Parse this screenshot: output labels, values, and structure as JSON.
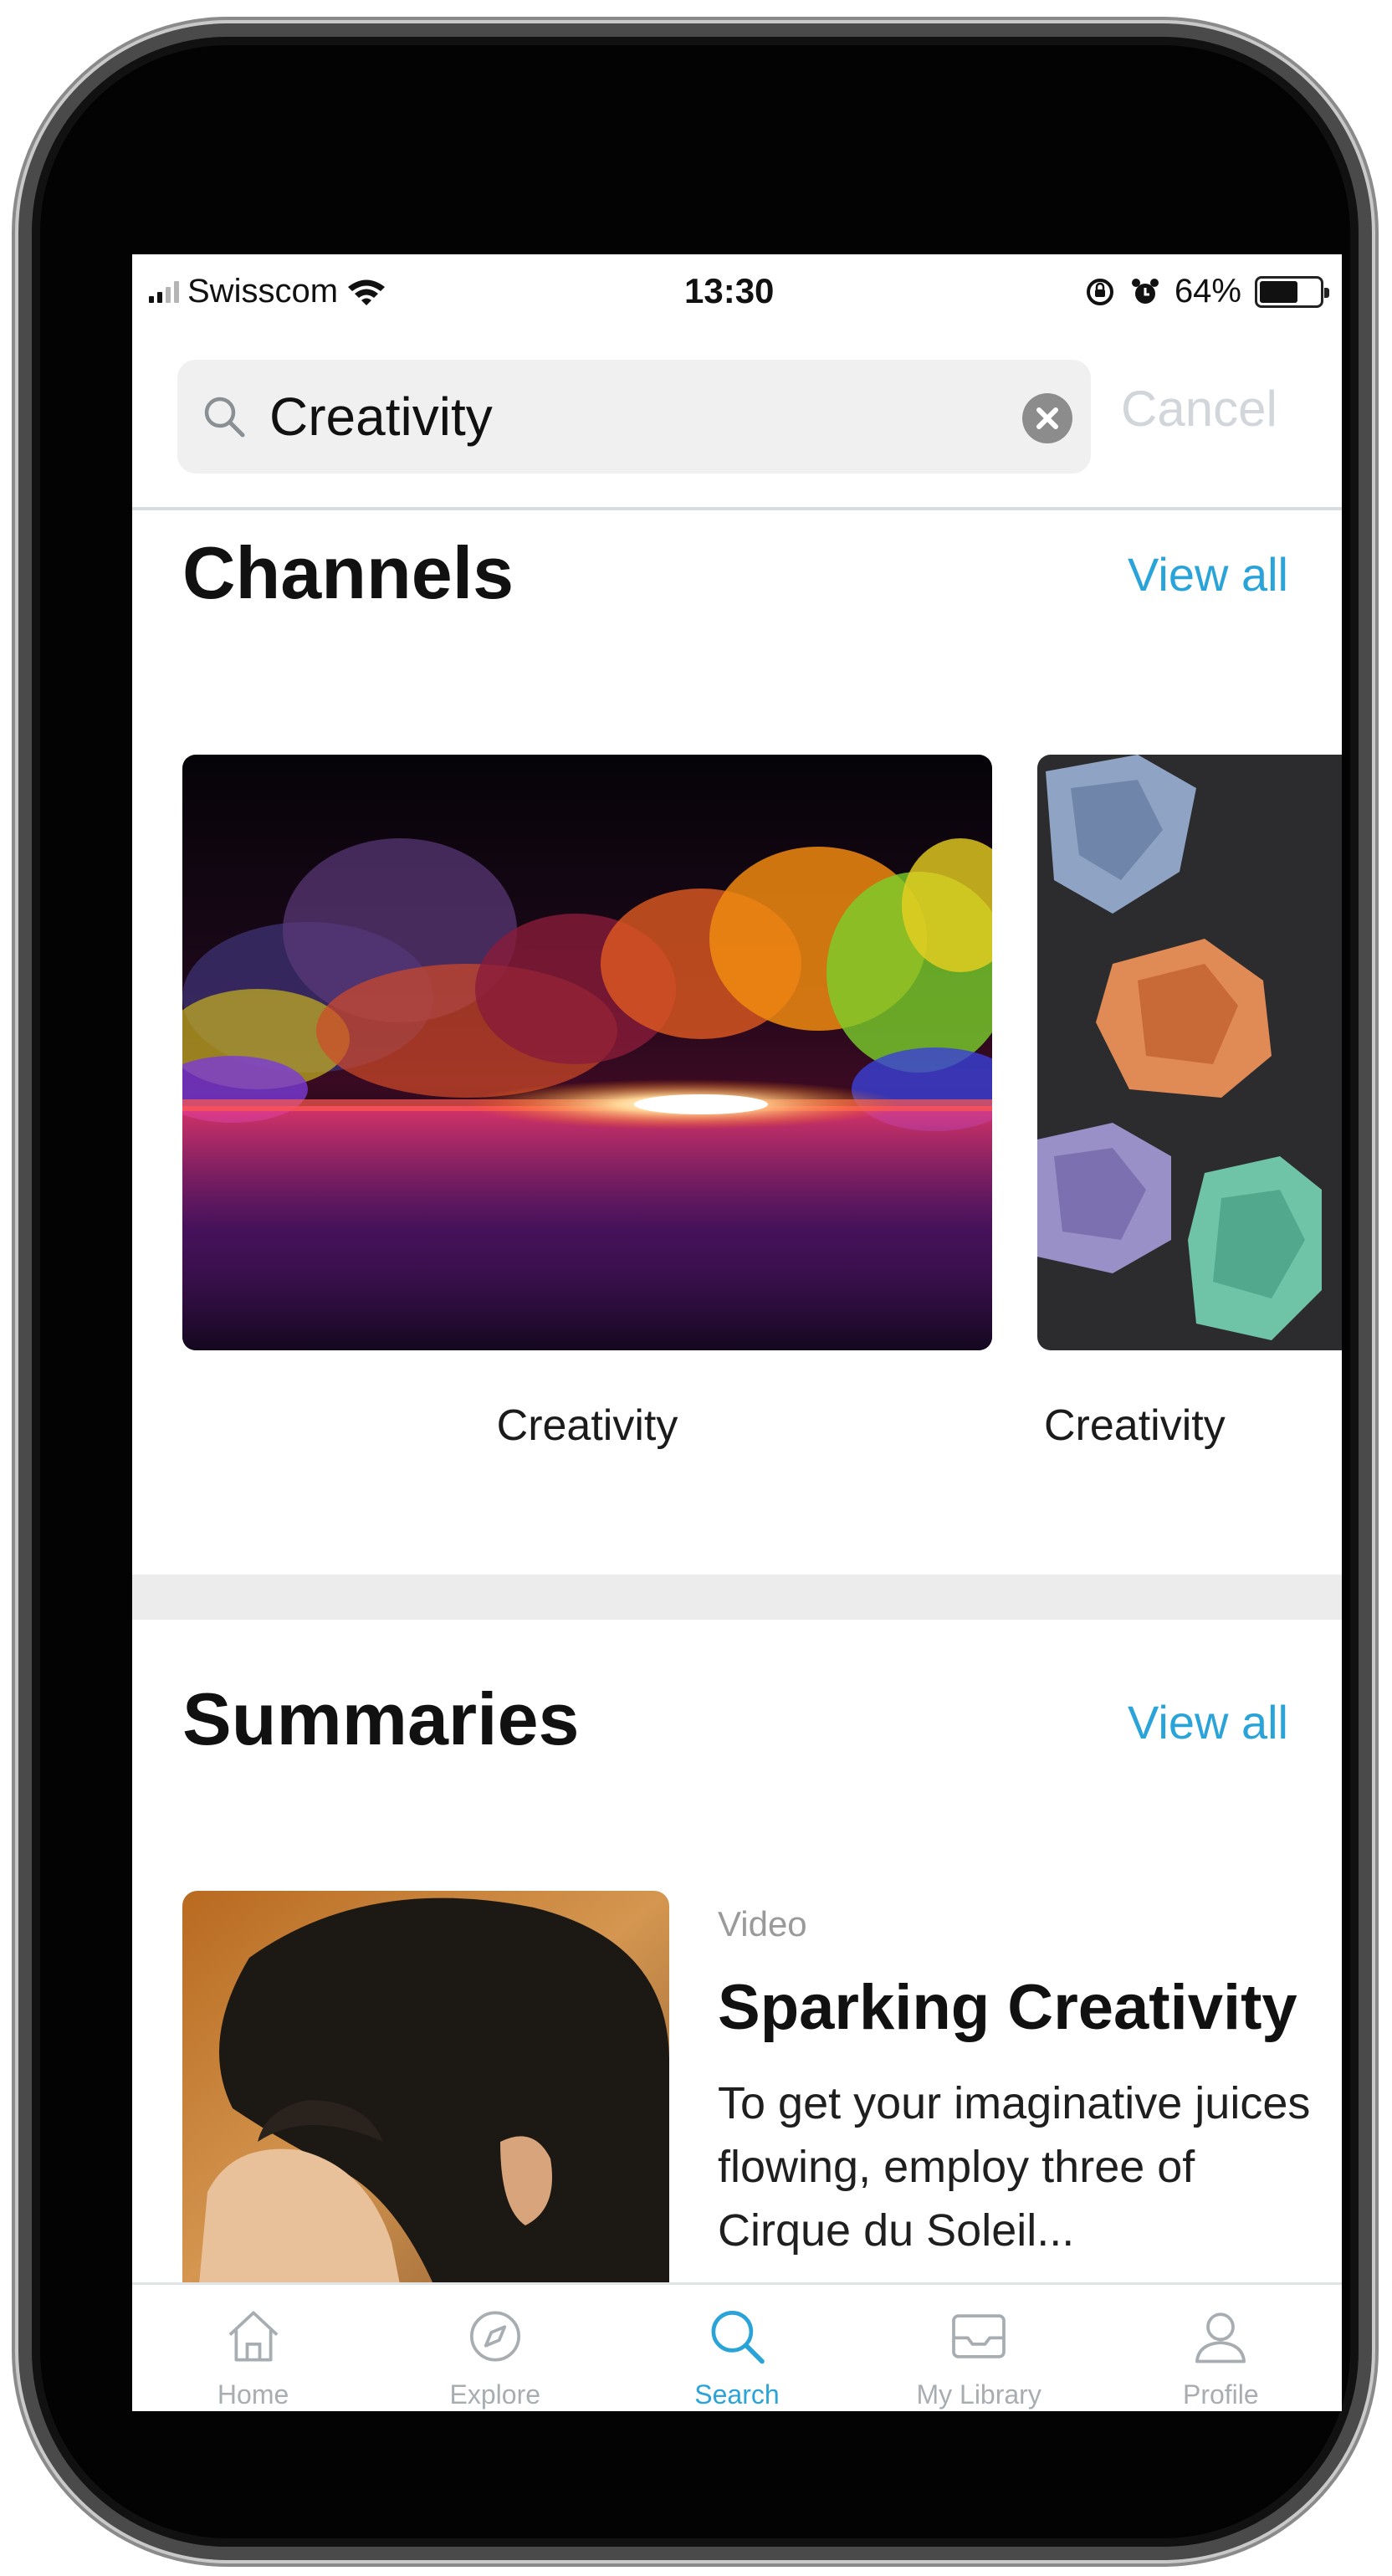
{
  "status_bar": {
    "carrier": "Swisscom",
    "time": "13:30",
    "battery_percent_label": "64%",
    "battery_level": 0.64,
    "icons": [
      "signal-icon",
      "wifi-icon",
      "rotation-lock-icon",
      "alarm-icon",
      "battery-icon"
    ]
  },
  "search": {
    "query": "Creativity",
    "cancel_label": "Cancel",
    "icons": [
      "search-icon",
      "clear-icon"
    ]
  },
  "channels": {
    "title": "Channels",
    "view_all_label": "View all",
    "items": [
      {
        "label": "Creativity"
      },
      {
        "label": "Creativity"
      }
    ]
  },
  "summaries": {
    "title": "Summaries",
    "view_all_label": "View all",
    "items": [
      {
        "type": "Video",
        "title": "Sparking Creativity",
        "description": "To get your imaginative juices flowing, employ three of Cirque du Soleil..."
      }
    ]
  },
  "tab_bar": {
    "active": "Search",
    "items": [
      {
        "label": "Home",
        "icon": "home-icon"
      },
      {
        "label": "Explore",
        "icon": "compass-icon"
      },
      {
        "label": "Search",
        "icon": "search-icon"
      },
      {
        "label": "My Library",
        "icon": "library-icon"
      },
      {
        "label": "Profile",
        "icon": "profile-icon"
      }
    ]
  },
  "colors": {
    "accent": "#2aa4d8",
    "inactive_tab": "#a8adb2",
    "search_field_bg": "#f0f0f1",
    "section_gap": "#ececed"
  }
}
